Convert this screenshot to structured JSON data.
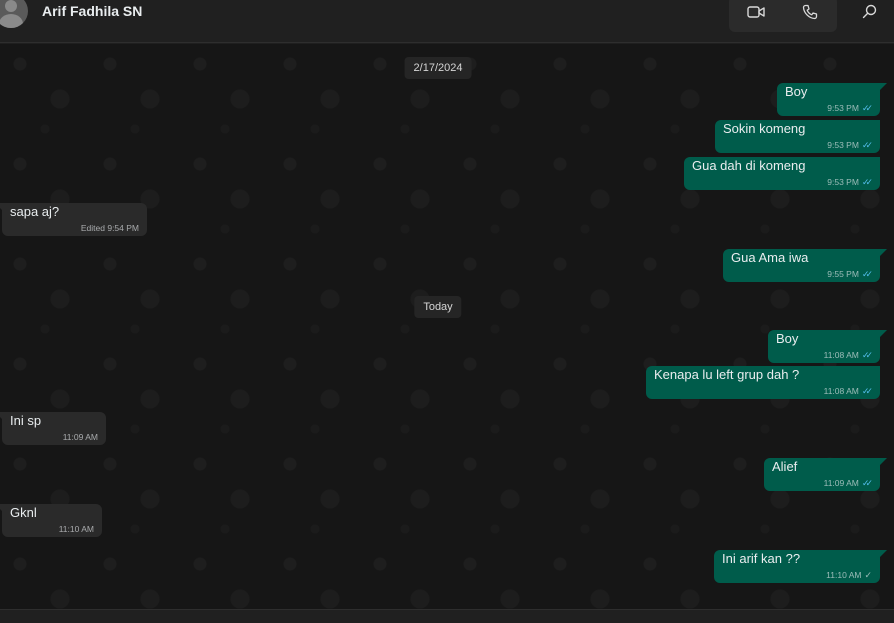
{
  "header": {
    "contact_name": "Arif Fadhila SN",
    "video_call_icon": "video-camera-icon",
    "voice_call_icon": "phone-icon",
    "search_icon": "search-icon"
  },
  "colors": {
    "outgoing_bubble": "#005c4b",
    "incoming_bubble": "#2a2a2a",
    "read_tick": "#53bdeb"
  },
  "chat": {
    "date_separators": [
      "2/17/2024",
      "Today"
    ],
    "messages": [
      {
        "direction": "out",
        "text": "Boy",
        "time": "9:53 PM",
        "status": "read"
      },
      {
        "direction": "out",
        "text": "Sokin komeng",
        "time": "9:53 PM",
        "status": "read"
      },
      {
        "direction": "out",
        "text": "Gua dah di komeng",
        "time": "9:53 PM",
        "status": "read"
      },
      {
        "direction": "in",
        "text": "sapa aj?",
        "time": "Edited 9:54 PM"
      },
      {
        "direction": "out",
        "text": "Gua Ama iwa",
        "time": "9:55 PM",
        "status": "read"
      },
      {
        "direction": "out",
        "text": "Boy",
        "time": "11:08 AM",
        "status": "read"
      },
      {
        "direction": "out",
        "text": "Kenapa lu left grup dah ?",
        "time": "11:08 AM",
        "status": "read"
      },
      {
        "direction": "in",
        "text": "Ini sp",
        "time": "11:09 AM"
      },
      {
        "direction": "out",
        "text": "Alief",
        "time": "11:09 AM",
        "status": "read"
      },
      {
        "direction": "in",
        "text": "Gknl",
        "time": "11:10 AM"
      },
      {
        "direction": "out",
        "text": "Ini arif kan ??",
        "time": "11:10 AM",
        "status": "sent"
      }
    ]
  }
}
